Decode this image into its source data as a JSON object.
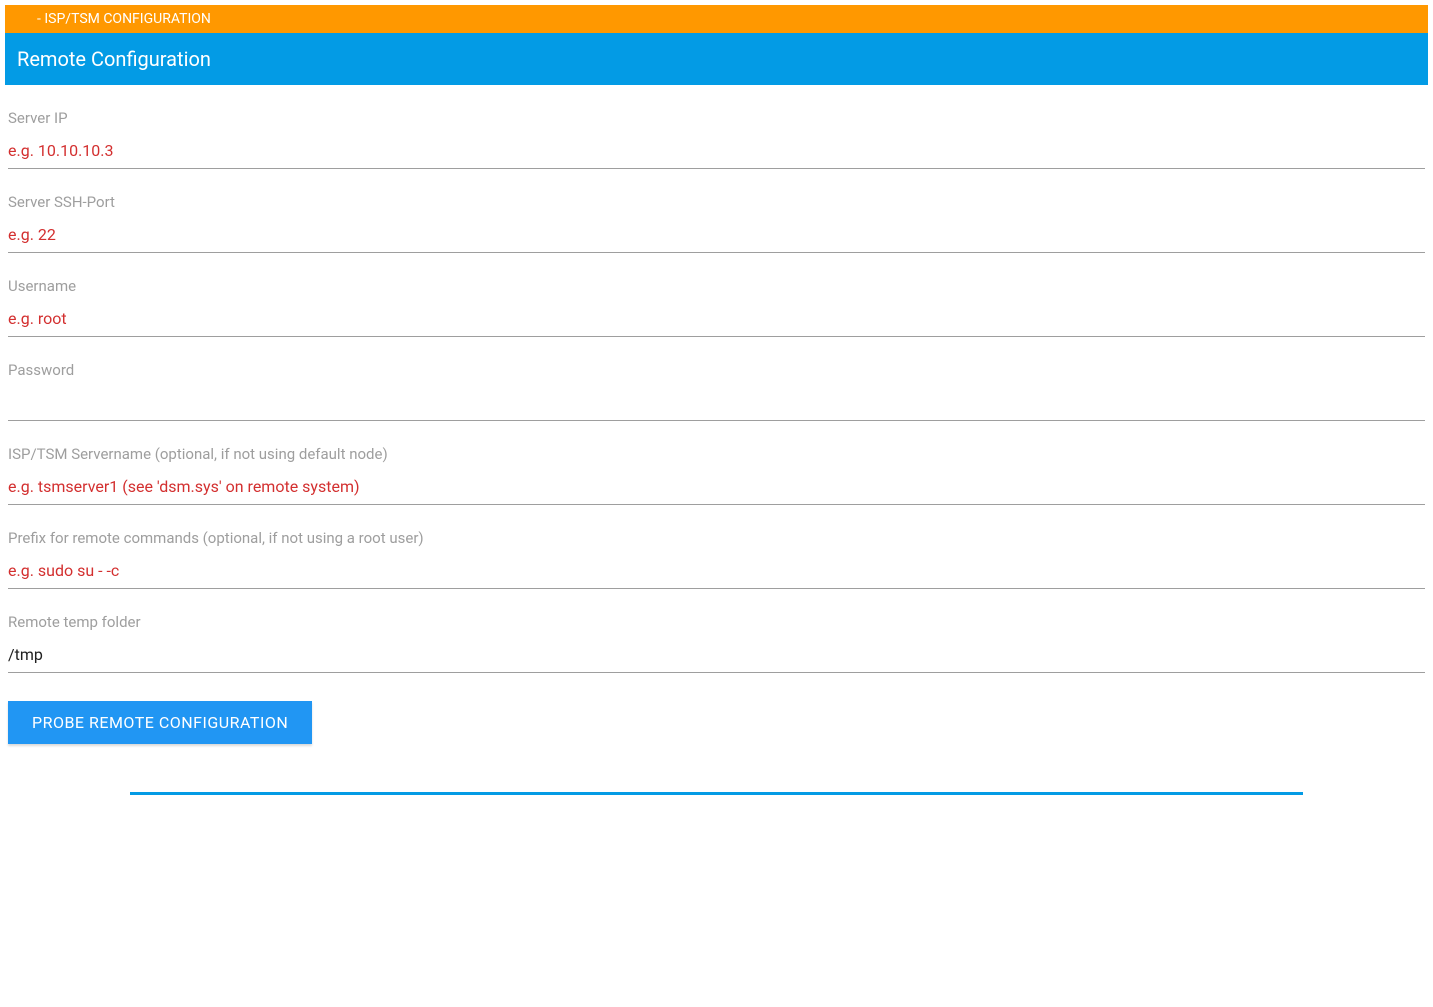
{
  "topBar": {
    "title": "- ISP/TSM CONFIGURATION"
  },
  "sectionHeader": {
    "title": "Remote Configuration"
  },
  "fields": {
    "serverIp": {
      "label": "Server IP",
      "placeholder": "e.g. 10.10.10.3",
      "value": ""
    },
    "serverSshPort": {
      "label": "Server SSH-Port",
      "placeholder": "e.g. 22",
      "value": ""
    },
    "username": {
      "label": "Username",
      "placeholder": "e.g. root",
      "value": ""
    },
    "password": {
      "label": "Password",
      "placeholder": "",
      "value": ""
    },
    "servername": {
      "label": "ISP/TSM Servername (optional, if not using default node)",
      "placeholder": "e.g. tsmserver1 (see 'dsm.sys' on remote system)",
      "value": ""
    },
    "prefix": {
      "label": "Prefix for remote commands (optional, if not using a root user)",
      "placeholder": "e.g. sudo su - -c",
      "value": ""
    },
    "tempFolder": {
      "label": "Remote temp folder",
      "placeholder": "",
      "value": "/tmp"
    }
  },
  "buttons": {
    "probe": "PROBE REMOTE CONFIGURATION"
  }
}
